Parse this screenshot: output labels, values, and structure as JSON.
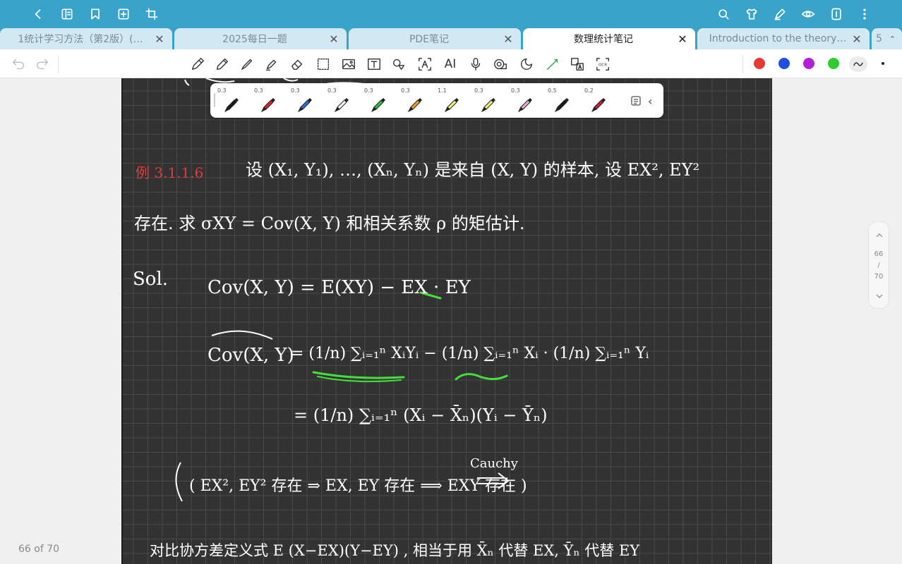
{
  "tabs": [
    {
      "label": "1统计学习方法（第2版）(…",
      "close": "✕"
    },
    {
      "label": "2025每日一题",
      "close": "✕"
    },
    {
      "label": "PDE笔记",
      "close": "✕"
    },
    {
      "label": "数理统计笔记",
      "close": "✕"
    },
    {
      "label": "Introduction to the theory…",
      "close": "✕"
    },
    {
      "label": "5"
    }
  ],
  "pens": [
    {
      "size": "0.3",
      "color": "#1a1a1a"
    },
    {
      "size": "0.3",
      "color": "#d9262c"
    },
    {
      "size": "0.3",
      "color": "#2a6fdb"
    },
    {
      "size": "0.3",
      "color": "#ffffff"
    },
    {
      "size": "0.3",
      "color": "#2fbf3a"
    },
    {
      "size": "0.3",
      "color": "#f0a020"
    },
    {
      "size": "1.1",
      "color": "#f3ee7a"
    },
    {
      "size": "0.3",
      "color": "#f3ee7a"
    },
    {
      "size": "0.3",
      "color": "#f3a6d6"
    },
    {
      "size": "0.5",
      "color": "#1a1a1a"
    },
    {
      "size": "0.2",
      "color": "#c4223a"
    }
  ],
  "palette": [
    "#e53935",
    "#1f4fe0",
    "#b320d6",
    "#2ecc2e"
  ],
  "page_counter": "66 of 70",
  "scroll": {
    "current": "66",
    "sep": "/",
    "total": "70"
  },
  "notes": {
    "example_label": "例 3.1.1.6",
    "line1": "设 (X₁, Y₁), …, (Xₙ, Yₙ) 是来自 (X, Y) 的样本, 设 EX², EY²",
    "line2": "存在. 求 σXY = Cov(X, Y) 和相关系数 ρ 的矩估计.",
    "sol": "Sol.",
    "eq1": "Cov(X, Y) = E(XY) − EX · EY",
    "eq2_lhs": "Cov(X, Y)",
    "eq2_rhs": "= (1/n) ∑ᵢ₌₁ⁿ XᵢYᵢ − (1/n) ∑ᵢ₌₁ⁿ Xᵢ · (1/n) ∑ᵢ₌₁ⁿ Yᵢ",
    "eq3": "= (1/n) ∑ᵢ₌₁ⁿ (Xᵢ − X̄ₙ)(Yᵢ − Ȳₙ)",
    "cauchy": "Cauchy",
    "eq4": "( EX², EY² 存在 ⇒ EX, EY 存在  ⟹  EXY 存在 )",
    "line_bottom": "对比协方差定义式   E (X−EX)(Y−EY) , 相当于用 X̄ₙ 代替 EX, Ȳₙ 代替 EY"
  }
}
